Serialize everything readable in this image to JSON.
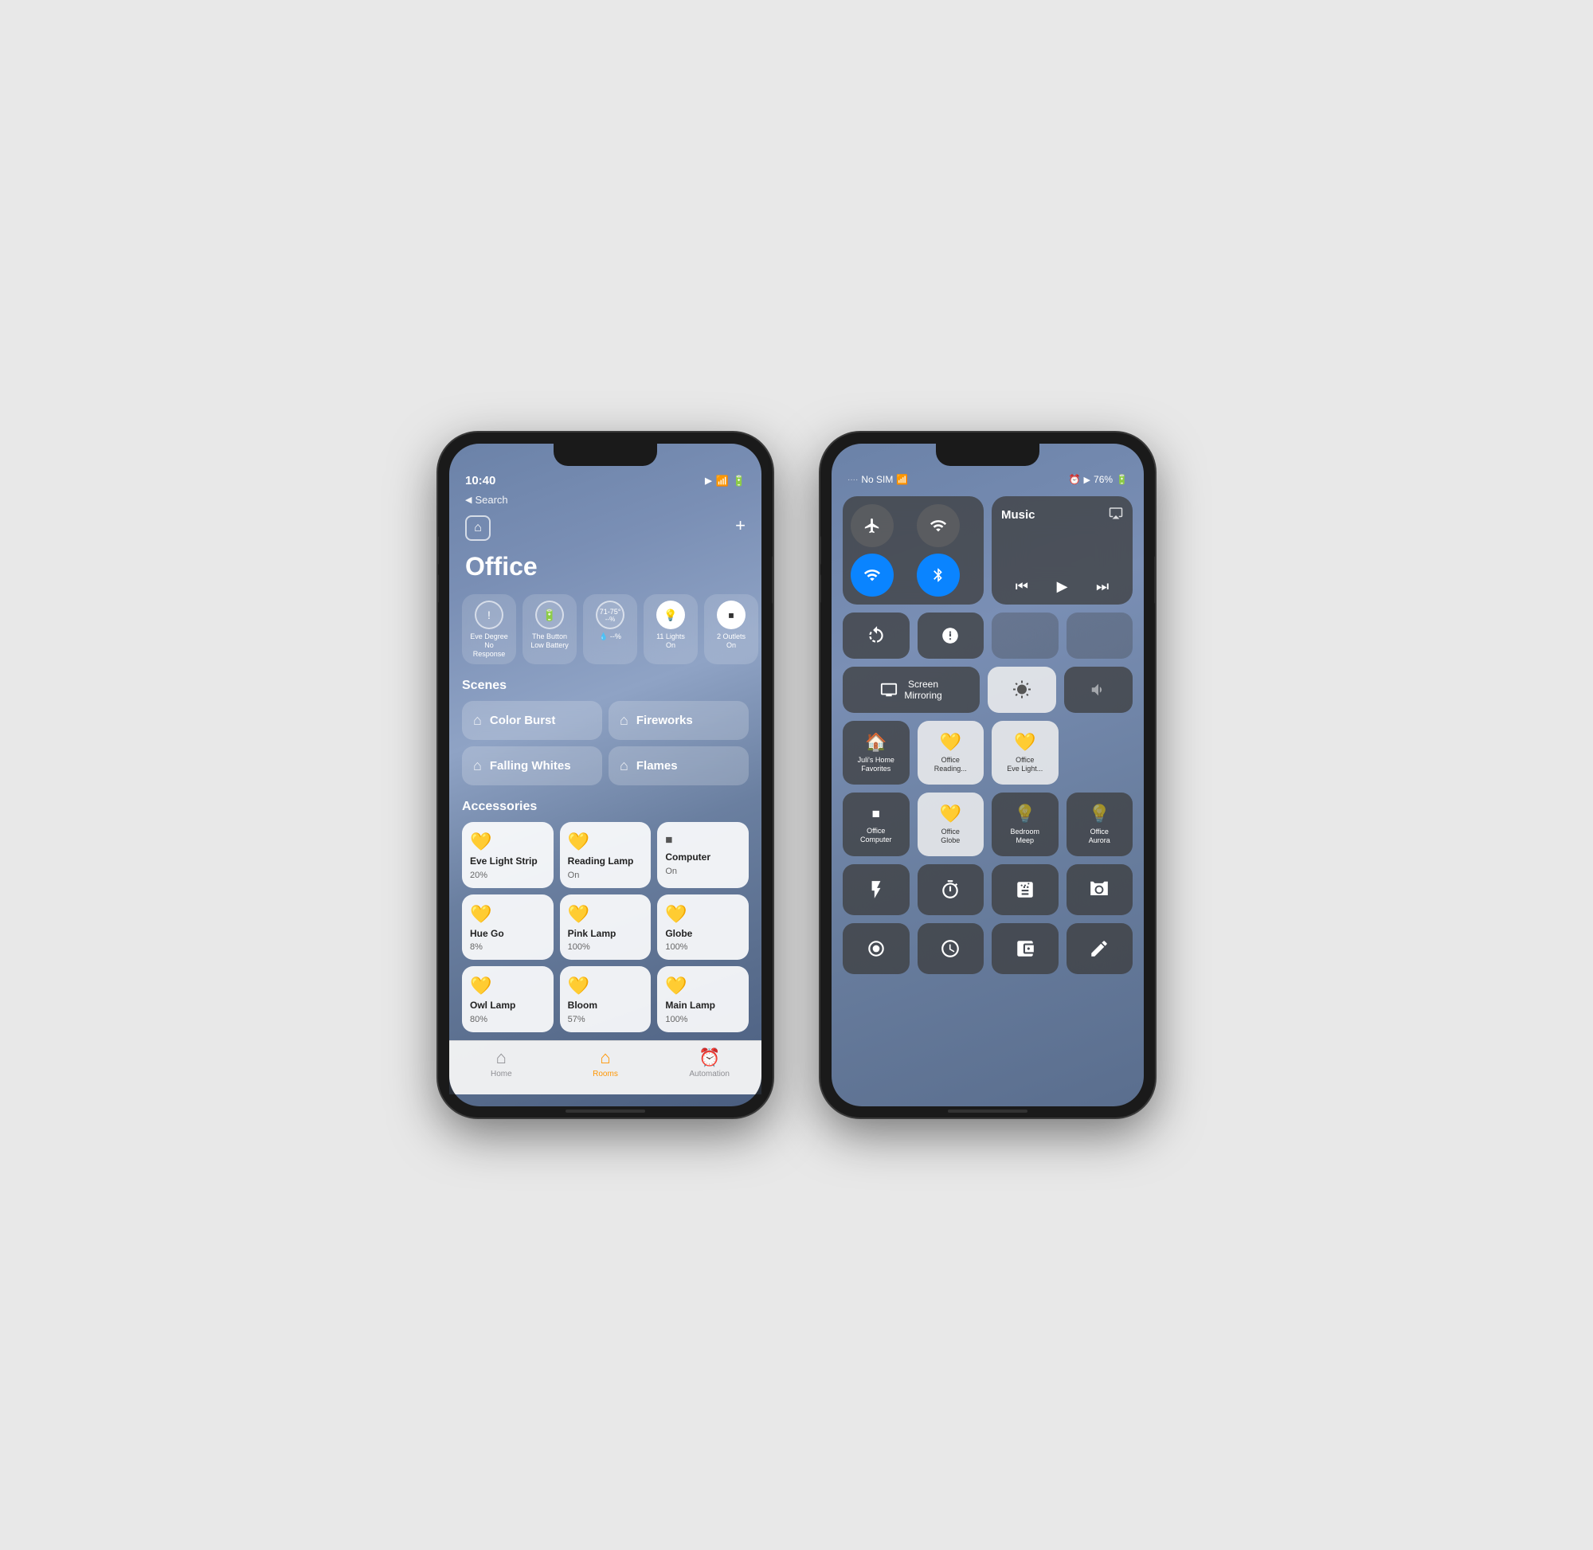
{
  "phone_left": {
    "status_bar": {
      "time": "10:40",
      "location_icon": "▶",
      "wifi_icon": "wifi",
      "battery_icon": "battery"
    },
    "back_label": "Search",
    "home_icon": "🏠",
    "add_icon": "+",
    "title": "Office",
    "status_tiles": [
      {
        "icon": "!",
        "label": "Eve Degree\nNo Response",
        "active": false
      },
      {
        "icon": "🔋",
        "label": "The Button\nLow Battery",
        "active": false
      },
      {
        "icon": "71–75°",
        "label": "  --%",
        "active": false
      },
      {
        "icon": "💡",
        "label": "11 Lights\nOn",
        "active": true
      },
      {
        "icon": "⏹",
        "label": "2 Outlets\nOn",
        "active": true
      }
    ],
    "sections": {
      "scenes_label": "Scenes",
      "accessories_label": "Accessories"
    },
    "scenes": [
      {
        "icon": "🏠",
        "label": "Color Burst"
      },
      {
        "icon": "🏠",
        "label": "Fireworks"
      },
      {
        "icon": "🏠",
        "label": "Falling Whites"
      },
      {
        "icon": "🏠",
        "label": "Flames"
      }
    ],
    "accessories": [
      {
        "icon": "💡",
        "name": "Eve Light\nStrip",
        "status": "20%",
        "type": "light"
      },
      {
        "icon": "💡",
        "name": "Reading\nLamp",
        "status": "On",
        "type": "light"
      },
      {
        "icon": "⏹",
        "name": "Computer",
        "status": "On",
        "type": "outlet"
      },
      {
        "icon": "💡",
        "name": "Hue Go",
        "status": "8%",
        "type": "light"
      },
      {
        "icon": "💡",
        "name": "Pink Lamp",
        "status": "100%",
        "type": "light"
      },
      {
        "icon": "💡",
        "name": "Globe",
        "status": "100%",
        "type": "light"
      },
      {
        "icon": "💡",
        "name": "Owl Lamp",
        "status": "80%",
        "type": "light"
      },
      {
        "icon": "💡",
        "name": "Bloom",
        "status": "57%",
        "type": "light"
      },
      {
        "icon": "💡",
        "name": "Main Lamp",
        "status": "100%",
        "type": "light"
      }
    ],
    "tabs": [
      {
        "icon": "🏠",
        "label": "Home",
        "active": false
      },
      {
        "icon": "🏠",
        "label": "Rooms",
        "active": true
      },
      {
        "icon": "⏰",
        "label": "Automation",
        "active": false
      }
    ]
  },
  "phone_right": {
    "status_bar": {
      "carrier": "No SIM",
      "wifi": "wifi",
      "alarm": "⏰",
      "location": "▶",
      "battery_pct": "76%",
      "battery": "battery"
    },
    "connectivity": [
      {
        "icon": "✈",
        "active": false
      },
      {
        "icon": "📡",
        "active": false
      },
      {
        "icon": "wifi",
        "active": true
      },
      {
        "icon": "bluetooth",
        "active": true
      }
    ],
    "music": {
      "label": "Music",
      "airplay_icon": "airplay",
      "prev_icon": "⏮",
      "play_icon": "▶",
      "next_icon": "⏭"
    },
    "util_buttons": [
      {
        "icon": "🔄",
        "label": "rotation-lock"
      },
      {
        "icon": "🌙",
        "label": "do-not-disturb"
      },
      {
        "icon": "⬜",
        "label": "empty"
      },
      {
        "icon": "⬜",
        "label": "empty2"
      }
    ],
    "screen_mirror_label": "Screen\nMirroring",
    "brightness_icon": "☀",
    "volume_icon": "🔊",
    "home_tiles": [
      {
        "icon": "🏠",
        "label": "Juli's Home\nFavorites",
        "light_bg": false
      },
      {
        "icon": "💡",
        "label": "Office\nReading...",
        "light_bg": true,
        "light_color": "yellow"
      },
      {
        "icon": "💡",
        "label": "Office\nEve Light...",
        "light_bg": true,
        "light_color": "yellow"
      },
      {
        "icon": "⏹",
        "label": "Office\nComputer",
        "light_bg": false
      },
      {
        "icon": "💡",
        "label": "Office\nGlobe",
        "light_bg": true,
        "light_color": "yellow"
      },
      {
        "icon": "💡",
        "label": "Bedroom\nMeep",
        "light_bg": false,
        "light_color": "gray"
      },
      {
        "icon": "💡",
        "label": "Office\nAurora",
        "light_bg": false,
        "light_color": "gray"
      }
    ],
    "app_buttons": [
      {
        "icon": "🔦",
        "label": "flashlight"
      },
      {
        "icon": "⏱",
        "label": "timer"
      },
      {
        "icon": "🧮",
        "label": "calculator"
      },
      {
        "icon": "📷",
        "label": "camera"
      },
      {
        "icon": "⏺",
        "label": "screen-record"
      },
      {
        "icon": "⏰",
        "label": "clock"
      },
      {
        "icon": "💳",
        "label": "wallet"
      },
      {
        "icon": "✏️",
        "label": "notes"
      }
    ]
  }
}
